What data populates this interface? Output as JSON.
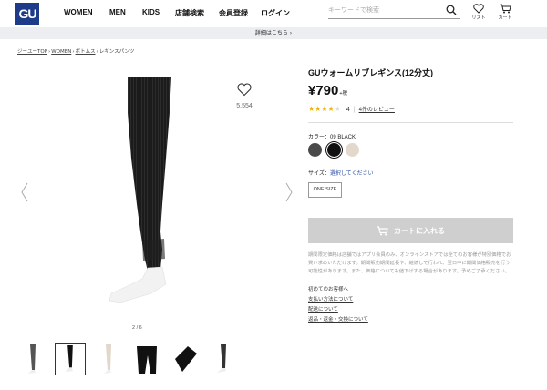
{
  "header": {
    "logo": "GU",
    "nav": [
      "WOMEN",
      "MEN",
      "KIDS",
      "店舗検索",
      "会員登録",
      "ログイン"
    ],
    "search_placeholder": "キーワードで検索",
    "list_label": "リスト",
    "cart_label": "カート"
  },
  "detail_bar": "詳細はこちら ›",
  "breadcrumb": [
    "ジーユーTOP",
    "WOMEN",
    "ボトムス",
    "レギンスパンツ"
  ],
  "gallery": {
    "favorite_count": "5,554",
    "pager": "2 / 6"
  },
  "product": {
    "title": "GUウォームリブレギンス(12分丈)",
    "price": "¥790",
    "tax": "+税",
    "rating_value": 4,
    "review_count": "4",
    "review_link": "4件のレビュー",
    "color_label": "カラー：09 BLACK",
    "colors": [
      "#4a4a4a",
      "#111111",
      "#e3d8cc"
    ],
    "size_label": "サイズ：",
    "size_select": "選択してください",
    "size_option": "ONE SIZE",
    "cart_button": "カートに入れる",
    "notice": "期間限定価格は店舗ではアプリ会員のみ、オンラインストアでは全てのお客様が特別価格でお買い求めいただけます。期間販売期間延長や、継続して行われ、翌日中に期間価格販売を行う可能性があります。また、価格についても値下げする場合があります。予めご了承ください。",
    "links": [
      "初めてのお客様へ",
      "支払い方法について",
      "配送について",
      "返品・返金・交換について"
    ]
  }
}
